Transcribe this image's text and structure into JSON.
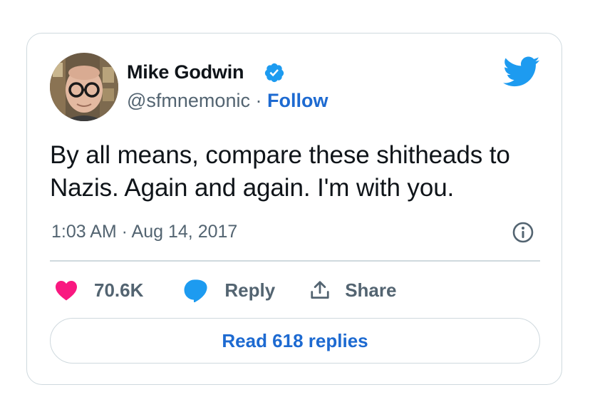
{
  "tweet": {
    "author_name": "Mike Godwin",
    "handle": "@sfmnemonic",
    "separator": " · ",
    "follow_label": "Follow",
    "text": "By all means, compare these shitheads to Nazis. Again and again. I'm with you.",
    "timestamp": "1:03 AM · Aug 14, 2017",
    "likes": "70.6K",
    "reply_label": "Reply",
    "share_label": "Share",
    "read_replies_label": "Read 618 replies"
  },
  "icons": {
    "verified": "verified-badge-icon",
    "brand": "twitter-bird-icon",
    "info": "info-icon",
    "like": "heart-icon",
    "reply": "speech-bubble-icon",
    "share": "share-upload-icon"
  },
  "colors": {
    "brand_blue": "#1d9bf0",
    "link_blue": "#1d6ad1",
    "like_pink": "#f91880",
    "muted_text": "#536471",
    "primary_text": "#0f1419",
    "border": "#cfd9de"
  }
}
